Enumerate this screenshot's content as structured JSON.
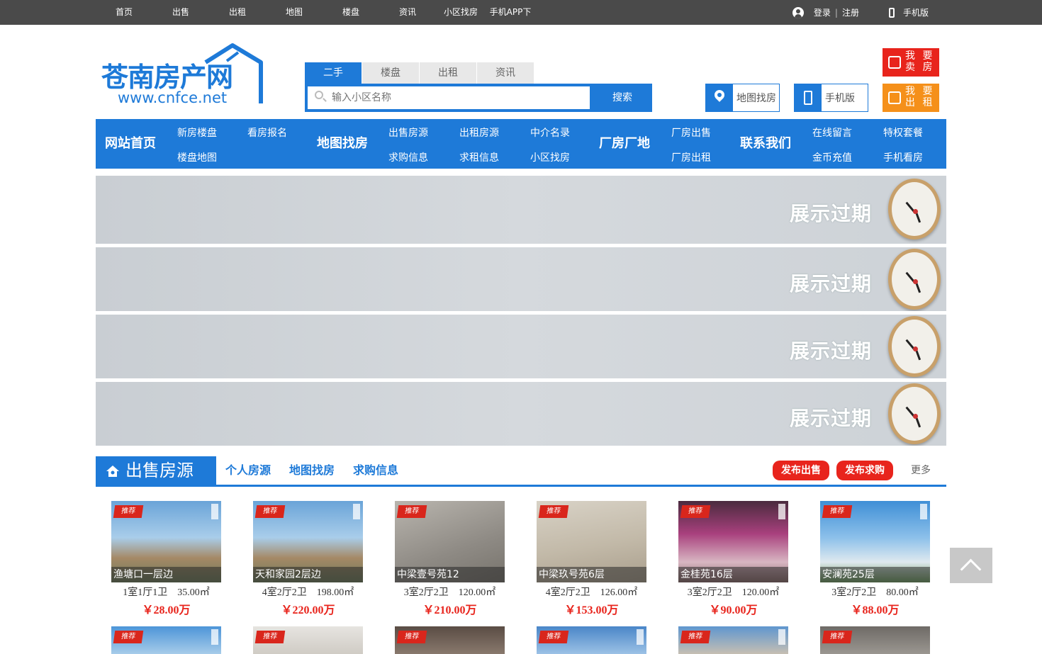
{
  "topbar": {
    "nav": [
      "首页",
      "出售",
      "出租",
      "地图",
      "楼盘",
      "资讯",
      "小区找房",
      "手机APP下载"
    ],
    "login": "登录",
    "divider": "|",
    "register": "注册",
    "mobile": "手机版"
  },
  "header": {
    "logo_title": "苍南房产网",
    "logo_url": "www.cnfce.net",
    "search_tabs": [
      "二手",
      "楼盘",
      "出租",
      "资讯"
    ],
    "search_placeholder": "输入小区名称",
    "search_button": "搜索",
    "map_button": "地图找房",
    "mobile_button": "手机版",
    "sell_button": "我 要 卖 房",
    "rent_button": "我 要 出 租"
  },
  "mainnav": {
    "home": "网站首页",
    "new_buildings": "新房楼盘",
    "viewing": "看房报名",
    "building_map": "楼盘地图",
    "map_search": "地图找房",
    "sale_listings": "出售房源",
    "rent_listings": "出租房源",
    "agents": "中介名录",
    "wanted_buy": "求购信息",
    "wanted_rent": "求租信息",
    "community": "小区找房",
    "factory": "厂房厂地",
    "factory_sale": "厂房出售",
    "factory_rent": "厂房出租",
    "contact": "联系我们",
    "message": "在线留言",
    "vip": "特权套餐",
    "recharge": "金币充值",
    "mobile_view": "手机看房"
  },
  "banners": [
    "展示过期",
    "展示过期",
    "展示过期",
    "展示过期"
  ],
  "section": {
    "title": "出售房源",
    "links": [
      "个人房源",
      "地图找房",
      "求购信息"
    ],
    "publish_sale": "发布出售",
    "publish_wanted": "发布求购",
    "more": "更多"
  },
  "listings": [
    {
      "tag": "推荐",
      "name": "渔塘口一层边",
      "spec": "1室1厅1卫　35.00㎡",
      "price": "￥28.00万"
    },
    {
      "tag": "推荐",
      "name": "天和家园2层边",
      "spec": "4室2厅2卫　198.00㎡",
      "price": "￥220.00万"
    },
    {
      "tag": "推荐",
      "name": "中梁壹号苑12",
      "spec": "3室2厅2卫　120.00㎡",
      "price": "￥210.00万"
    },
    {
      "tag": "推荐",
      "name": "中梁玖号苑6层",
      "spec": "4室2厅2卫　126.00㎡",
      "price": "￥153.00万"
    },
    {
      "tag": "推荐",
      "name": "金桂苑16层",
      "spec": "3室2厅2卫　120.00㎡",
      "price": "￥90.00万"
    },
    {
      "tag": "推荐",
      "name": "安澜苑25层",
      "spec": "3室2厅2卫　80.00㎡",
      "price": "￥88.00万"
    }
  ],
  "listings_row2_tags": [
    "推荐",
    "推荐",
    "推荐",
    "推荐",
    "推荐",
    "推荐"
  ]
}
